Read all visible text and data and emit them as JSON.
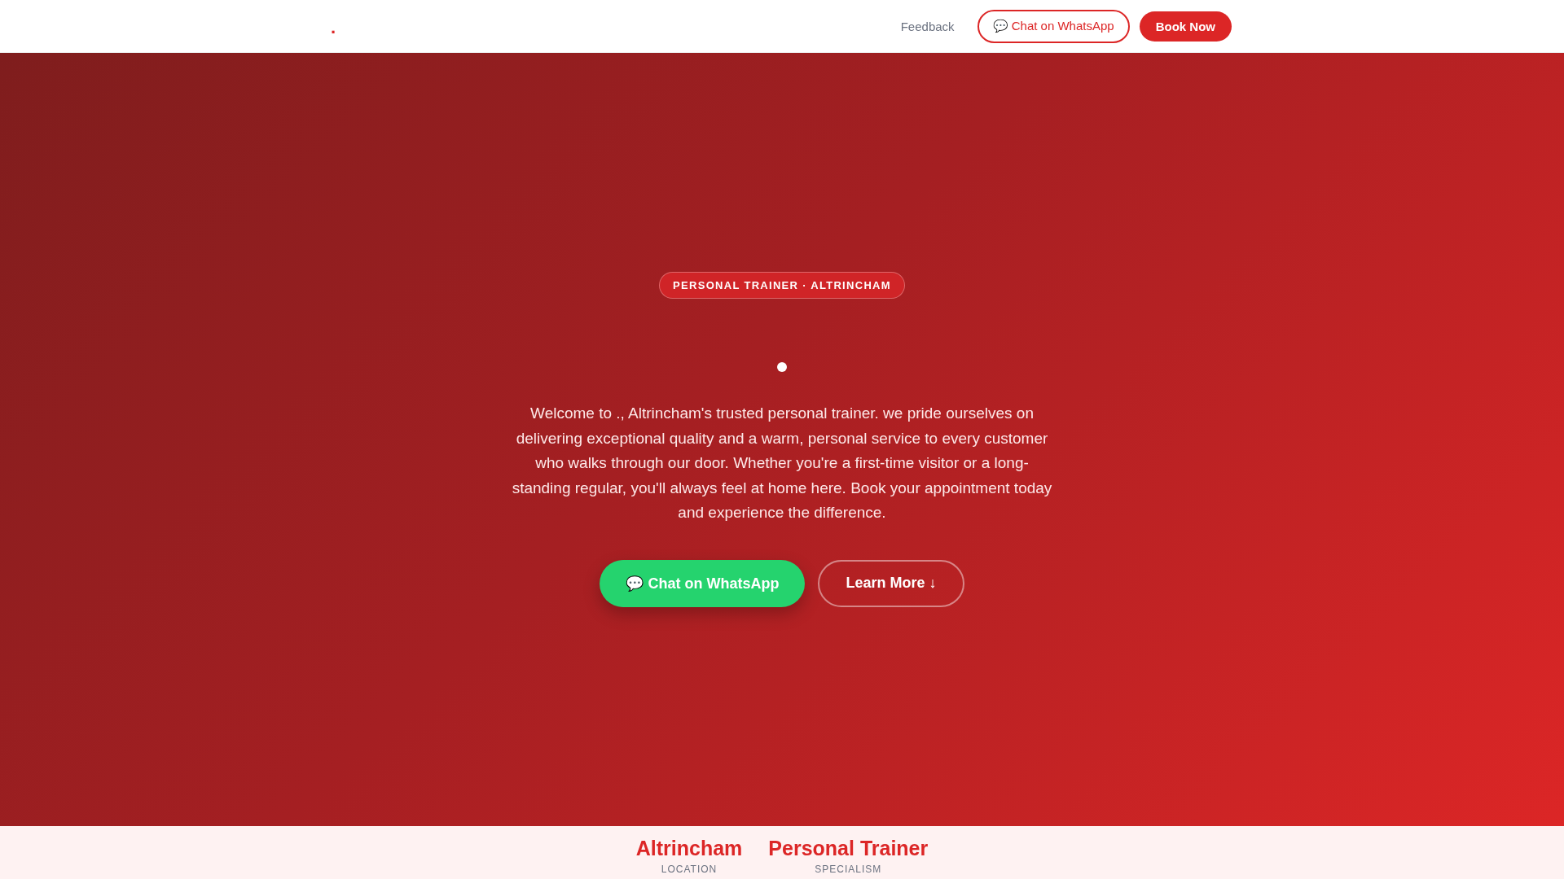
{
  "header": {
    "logo": ".",
    "nav": [
      {
        "kind": "link",
        "label": "Feedback"
      },
      {
        "kind": "outline",
        "label": "💬 Chat on WhatsApp"
      },
      {
        "kind": "solid",
        "label": "Book Now"
      }
    ]
  },
  "hero": {
    "badge": "PERSONAL TRAINER · ALTRINCHAM",
    "dot": true,
    "text": "Welcome to ., Altrincham's trusted personal trainer. we pride ourselves on delivering exceptional quality and a warm, personal service to every customer who walks through our door. Whether you're a first-time visitor or a long-standing regular, you'll always feel at home here. Book your appointment today and experience the difference.",
    "buttons": [
      {
        "kind": "whatsapp",
        "label": "💬 Chat on WhatsApp"
      },
      {
        "kind": "ghost",
        "label": "Learn More ↓"
      }
    ]
  },
  "stats": [
    {
      "value": "Altrincham",
      "label": "LOCATION"
    },
    {
      "value": "Personal Trainer",
      "label": "SPECIALISM"
    }
  ]
}
